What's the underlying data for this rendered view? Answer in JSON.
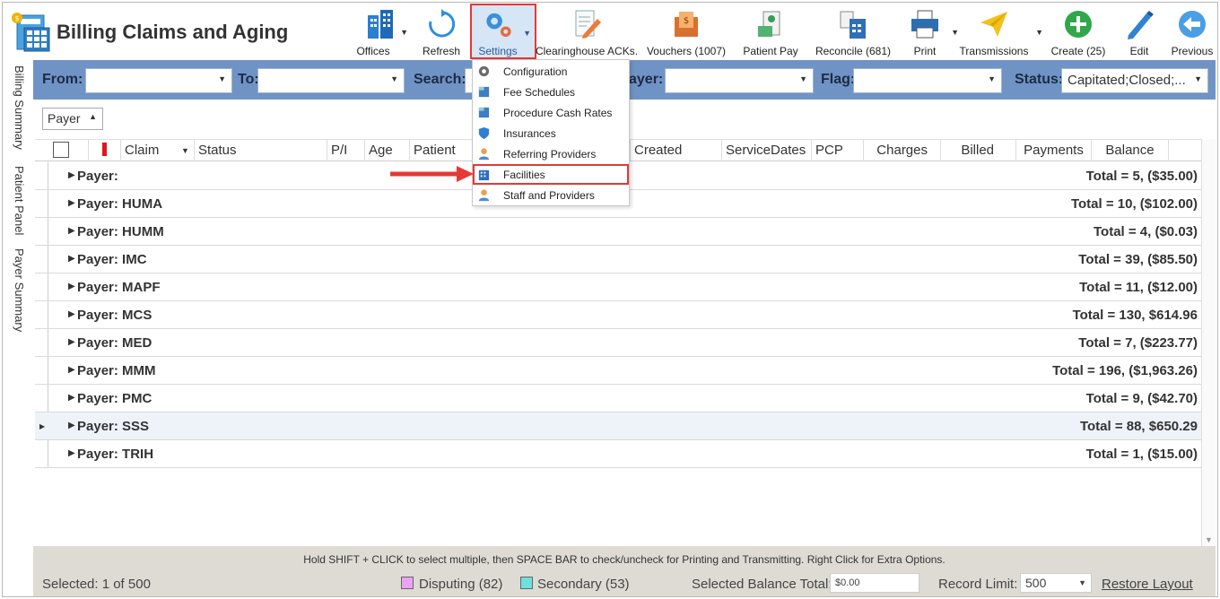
{
  "app": {
    "title": "Billing Claims and Aging"
  },
  "toolbar": {
    "offices": "Offices",
    "refresh": "Refresh",
    "settings": "Settings",
    "clearinghouse": "Clearinghouse ACKs.",
    "vouchers": "Vouchers (1007)",
    "patient_pay": "Patient Pay",
    "reconcile": "Reconcile (681)",
    "print": "Print",
    "transmissions": "Transmissions",
    "create": "Create (25)",
    "edit": "Edit",
    "previous": "Previous"
  },
  "filters": {
    "from_label": "From:",
    "from_value": "",
    "to_label": "To:",
    "to_value": "",
    "search_label": "Search:",
    "payer_label": "ayer:",
    "payer_value": "",
    "flag_label": "Flag:",
    "flag_value": "",
    "status_label": "Status:",
    "status_value": "Capitated;Closed;..."
  },
  "side_tabs": [
    "Billing Summary",
    "Patient Panel",
    "Payer Summary"
  ],
  "group_chip": "Payer",
  "columns": [
    "Claim",
    "Status",
    "P/I",
    "Age",
    "Patient",
    "Created",
    "ServiceDates",
    "PCP",
    "Charges",
    "Billed",
    "Payments",
    "Balance"
  ],
  "rows": [
    {
      "group": "Payer:",
      "total": "Total = 5,  ($35.00)"
    },
    {
      "group": "Payer: HUMA",
      "total": "Total = 10,  ($102.00)"
    },
    {
      "group": "Payer: HUMM",
      "total": "Total = 4,  ($0.03)"
    },
    {
      "group": "Payer: IMC",
      "total": "Total = 39,  ($85.50)"
    },
    {
      "group": "Payer: MAPF",
      "total": "Total = 11,  ($12.00)"
    },
    {
      "group": "Payer: MCS",
      "total": "Total = 130,  $614.96"
    },
    {
      "group": "Payer: MED",
      "total": "Total = 7,  ($223.77)"
    },
    {
      "group": "Payer: MMM",
      "total": "Total = 196,  ($1,963.26)"
    },
    {
      "group": "Payer: PMC",
      "total": "Total = 9,  ($42.70)"
    },
    {
      "group": "Payer: SSS",
      "total": "Total = 88,  $650.29"
    },
    {
      "group": "Payer: TRIH",
      "total": "Total = 1,  ($15.00)"
    }
  ],
  "settings_menu": [
    "Configuration",
    "Fee Schedules",
    "Procedure Cash Rates",
    "Insurances",
    "Referring Providers",
    "Facilities",
    "Staff and Providers"
  ],
  "footer": {
    "hint": "Hold SHIFT + CLICK to select multiple, then SPACE BAR to check/uncheck for Printing and Transmitting. Right Click for Extra Options.",
    "selected": "Selected: 1 of 500",
    "disputing": "Disputing (82)",
    "secondary": "Secondary (53)",
    "balance_label": "Selected Balance Total:",
    "balance_value": "$0.00",
    "limit_label": "Record Limit:",
    "limit_value": "500",
    "restore": "Restore Layout"
  },
  "colors": {
    "filter_bar": "#6f93c5",
    "highlight": "#e53935",
    "disputing": "#e9a3f2",
    "secondary": "#6fe0dc",
    "flag": "#e0141e"
  }
}
